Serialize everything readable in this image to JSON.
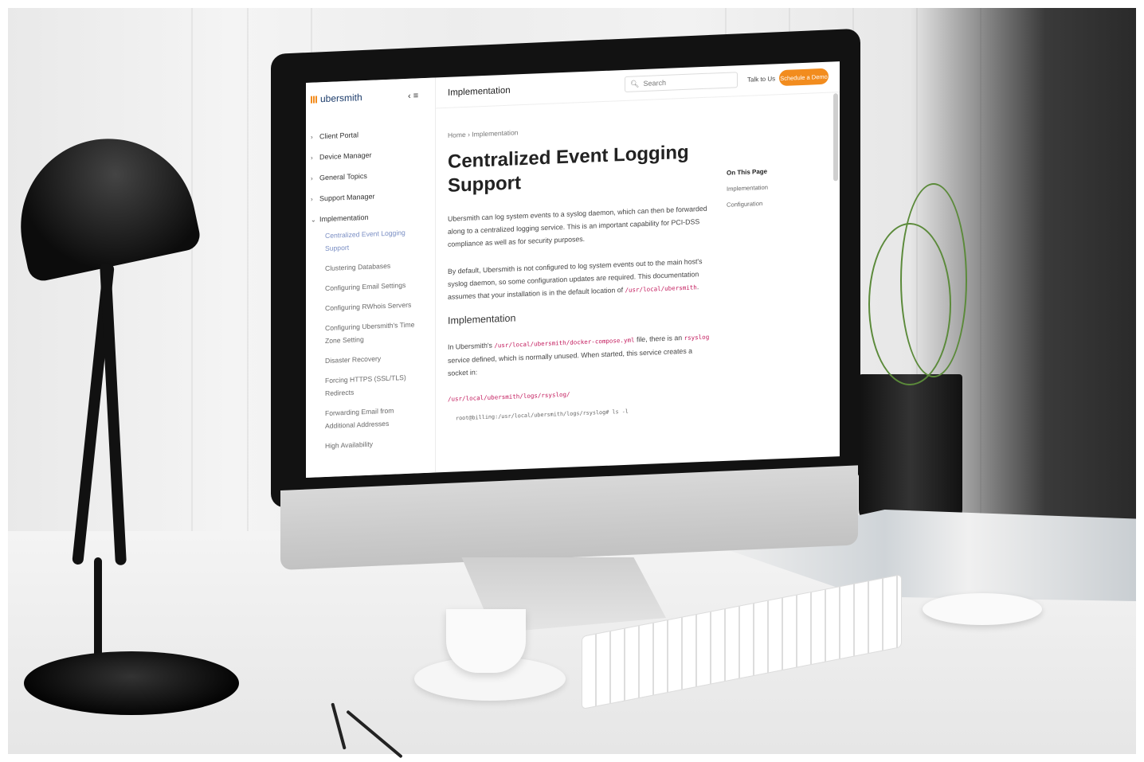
{
  "app": {
    "logo_text": "ubersmith",
    "section_title": "Implementation",
    "search_placeholder": "Search",
    "talk_label": "Talk to Us",
    "demo_label": "Schedule a Demo"
  },
  "sidebar": {
    "items": [
      {
        "label": "Client Portal",
        "expanded": false
      },
      {
        "label": "Device Manager",
        "expanded": false
      },
      {
        "label": "General Topics",
        "expanded": false
      },
      {
        "label": "Support Manager",
        "expanded": false
      },
      {
        "label": "Implementation",
        "expanded": true
      }
    ],
    "sub_items": [
      "Centralized Event Logging Support",
      "Clustering Databases",
      "Configuring Email Settings",
      "Configuring RWhois Servers",
      "Configuring Ubersmith's Time Zone Setting",
      "Disaster Recovery",
      "Forcing HTTPS (SSL/TLS) Redirects",
      "Forwarding Email from Additional Addresses",
      "High Availability"
    ],
    "active_sub_index": 0
  },
  "breadcrumb": {
    "home": "Home",
    "sep": "›",
    "current": "Implementation"
  },
  "article": {
    "title": "Centralized Event Logging Support",
    "p1": "Ubersmith can log system events to a syslog daemon, which can then be forwarded along to a centralized logging service. This is an important capability for PCI-DSS compliance as well as for security purposes.",
    "p2_pre": "By default, Ubersmith is not configured to log system events out to the main host's syslog daemon, so some configuration updates are required. This documentation assumes that your installation is in the default location of ",
    "p2_code": "/usr/local/ubersmith",
    "p2_post": ".",
    "h2": "Implementation",
    "p3_a": "In Ubersmith's ",
    "p3_code1": "/usr/local/ubersmith/docker-compose.yml",
    "p3_b": " file, there is an ",
    "p3_code2": "rsyslog",
    "p3_c": " service defined, which is normally unused. When started, this service creates a socket in:",
    "path": "/usr/local/ubersmith/logs/rsyslog/",
    "terminal": "root@billing:/usr/local/ubersmith/logs/rsyslog# ls -l"
  },
  "toc": {
    "heading": "On This Page",
    "items": [
      "Implementation",
      "Configuration"
    ]
  },
  "colors": {
    "accent": "#f28c1e",
    "active_link": "#7b8fc4",
    "code": "#c2185b"
  }
}
